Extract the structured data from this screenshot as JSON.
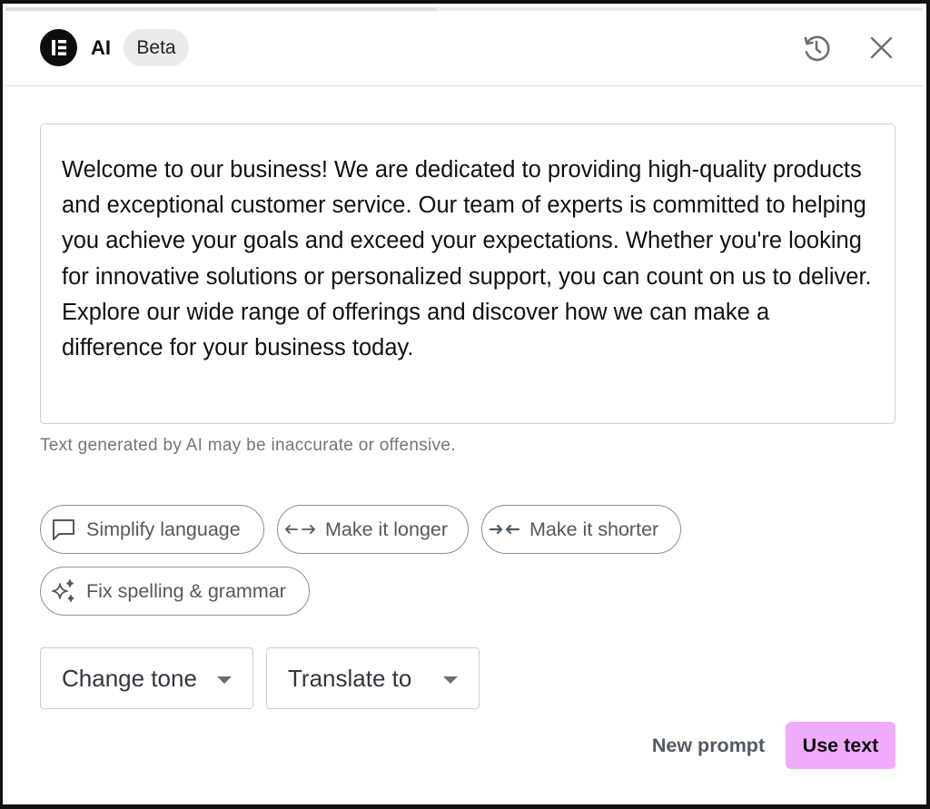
{
  "header": {
    "logo_icon": "elementor-logo-icon",
    "title": "AI",
    "badge": "Beta",
    "history_icon": "history-icon",
    "close_icon": "close-icon"
  },
  "progress": {
    "value_percent": 47
  },
  "result": {
    "text": "Welcome to our business! We are dedicated to providing high-quality products and exceptional customer service. Our team of experts is committed to helping you achieve your goals and exceed your expectations. Whether you're looking for innovative solutions or personalized support, you can count on us to deliver. Explore our wide range of offerings and discover how we can make a difference for your business today.",
    "disclaimer": "Text generated by AI may be inaccurate or offensive."
  },
  "actions": [
    {
      "label": "Simplify language",
      "icon": "speech-bubble-icon"
    },
    {
      "label": "Make it longer",
      "icon": "expand-arrows-icon"
    },
    {
      "label": "Make it shorter",
      "icon": "shrink-arrows-icon"
    },
    {
      "label": "Fix spelling & grammar",
      "icon": "sparkles-icon"
    }
  ],
  "selects": {
    "tone": {
      "label": "Change tone"
    },
    "translate": {
      "label": "Translate to"
    }
  },
  "footer": {
    "new_prompt": "New prompt",
    "use_text": "Use text"
  },
  "colors": {
    "accent": "#f0abfc",
    "muted_text": "#515962",
    "border": "#cfcfcf"
  }
}
